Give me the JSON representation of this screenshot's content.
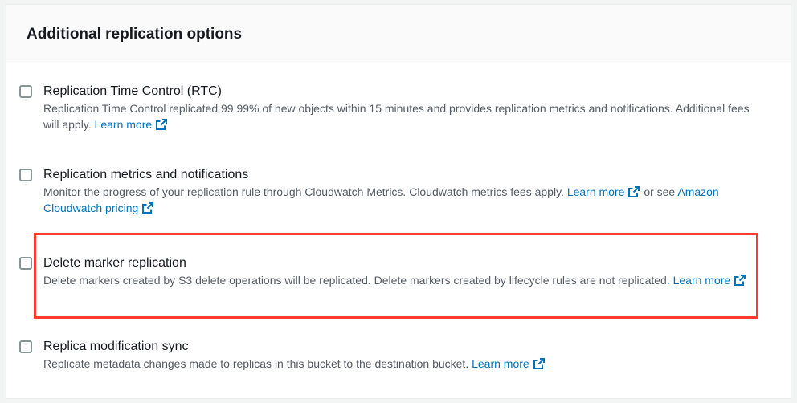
{
  "panel": {
    "title": "Additional replication options"
  },
  "options": [
    {
      "label": "Replication Time Control (RTC)",
      "desc_before": "Replication Time Control replicated 99.99% of new objects within 15 minutes and provides replication metrics and notifications. Additional fees will apply.",
      "link1": "Learn more",
      "checked": false
    },
    {
      "label": "Replication metrics and notifications",
      "desc_before": "Monitor the progress of your replication rule through Cloudwatch Metrics. Cloudwatch metrics fees apply.",
      "link1": "Learn more",
      "desc_middle": "or see",
      "link2": "Amazon Cloudwatch pricing",
      "checked": false
    },
    {
      "label": "Delete marker replication",
      "desc_before": "Delete markers created by S3 delete operations will be replicated. Delete markers created by lifecycle rules are not replicated.",
      "link1": "Learn more",
      "checked": false
    },
    {
      "label": "Replica modification sync",
      "desc_before": "Replicate metadata changes made to replicas in this bucket to the destination bucket.",
      "link1": "Learn more",
      "checked": false
    }
  ],
  "icons": {
    "external_link": "external-link-icon"
  },
  "colors": {
    "link": "#0073bb",
    "highlight": "#ff3b30",
    "checkbox_border": "#879596"
  }
}
